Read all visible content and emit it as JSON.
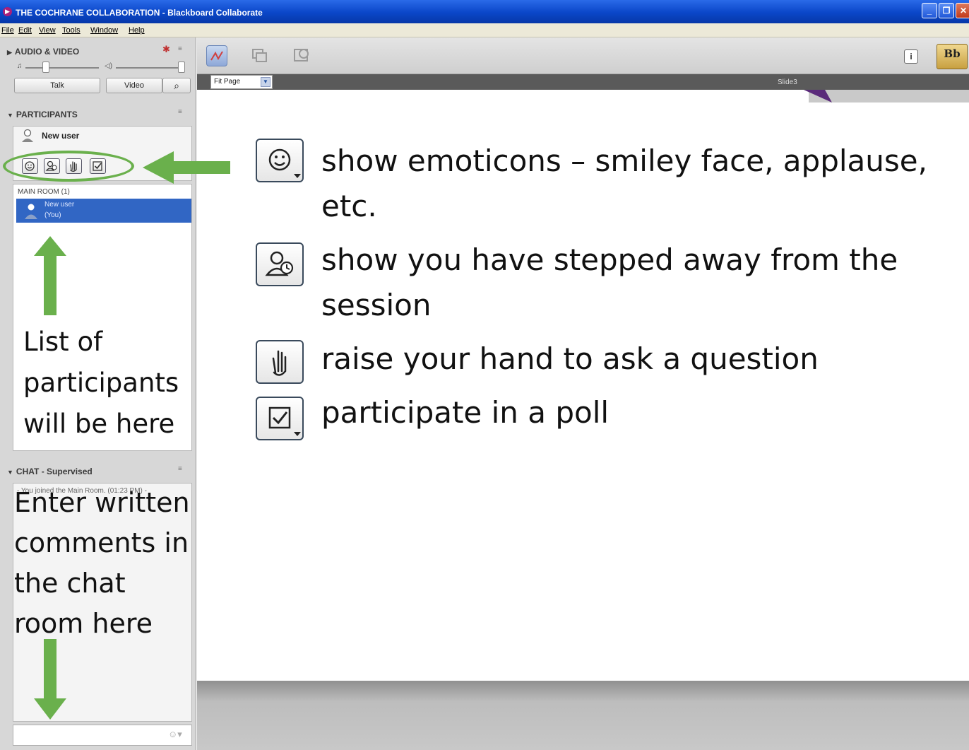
{
  "window": {
    "title": "THE COCHRANE COLLABORATION - Blackboard Collaborate",
    "controls": [
      "_",
      "❐",
      "✕"
    ]
  },
  "menu": [
    "File",
    "Edit",
    "View",
    "Tools",
    "Window",
    "Help"
  ],
  "audio_video": {
    "header": "AUDIO & VIDEO",
    "talk_label": "Talk",
    "video_label": "Video"
  },
  "participants": {
    "header": "PARTICIPANTS",
    "current_user": "New user",
    "room_title": "MAIN ROOM (1)",
    "list": [
      {
        "name": "New user",
        "note": "(You)"
      }
    ],
    "annotation": "List of\nparticipants\nwill be here"
  },
  "chat": {
    "header": "CHAT - Supervised",
    "system_message": "- You joined the Main Room. (01:23 PM) -",
    "annotation": "Enter written\ncomments in\nthe chat\nroom here"
  },
  "whiteboard": {
    "zoom": "Fit Page",
    "slide_label": "Slide3",
    "bb_logo": "Bb"
  },
  "legend": [
    {
      "icon": "smiley-icon",
      "text": "show emoticons – smiley face, applause, etc."
    },
    {
      "icon": "away-icon",
      "text": "show you have stepped away from the session"
    },
    {
      "icon": "raise-hand-icon",
      "text": "raise your hand to ask a question"
    },
    {
      "icon": "poll-icon",
      "text": "participate in a poll"
    }
  ],
  "colors": {
    "arrow": "#6ab04c",
    "title_bar": "#0a46c8",
    "selection": "#3166c4"
  }
}
